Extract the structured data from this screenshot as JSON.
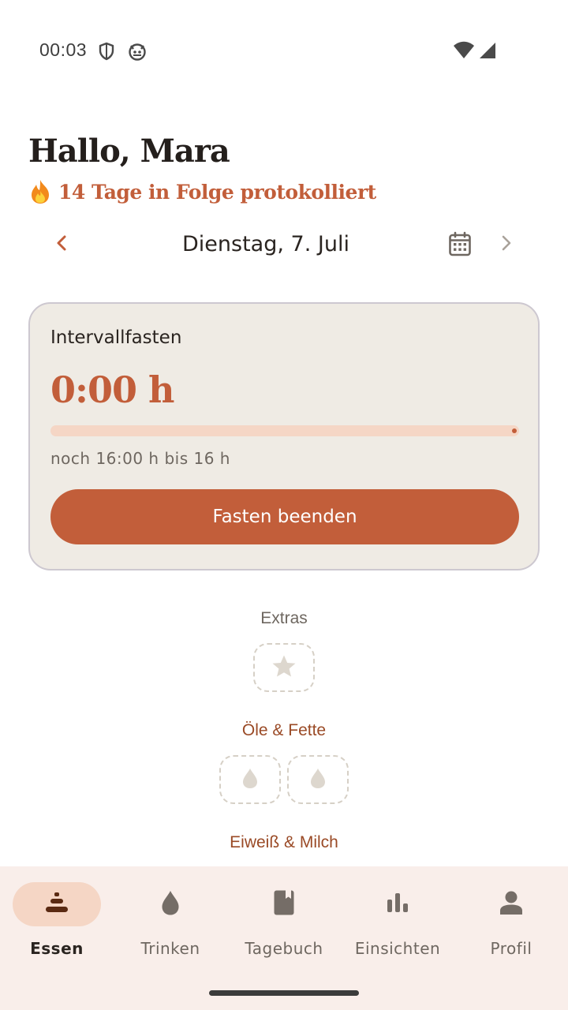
{
  "status_bar": {
    "time": "00:03",
    "icons": [
      "shield-icon",
      "cat-face-icon",
      "wifi-icon",
      "cell-signal-icon"
    ]
  },
  "header": {
    "greeting": "Hallo, Mara",
    "streak_text": "14 Tage in Folge protokolliert",
    "streak_icon": "flame-icon"
  },
  "date_nav": {
    "date": "Dienstag, 7. Juli",
    "prev_icon": "chevron-left-icon",
    "next_icon": "chevron-right-icon",
    "calendar_icon": "calendar-icon"
  },
  "fasting": {
    "title": "Intervallfasten",
    "elapsed": "0:00 h",
    "progress_fraction": 0,
    "remaining": "noch 16:00 h bis 16 h",
    "button_label": "Fasten beenden"
  },
  "sections": {
    "extras": {
      "label": "Extras",
      "slots": [
        "star-icon"
      ]
    },
    "oils": {
      "label": "Öle & Fette",
      "slots": [
        "drop-icon",
        "drop-icon"
      ]
    },
    "protein": {
      "label": "Eiweiß & Milch"
    }
  },
  "bottom_nav": {
    "active": "Essen",
    "items": [
      {
        "label": "Essen",
        "icon": "food-stack-icon"
      },
      {
        "label": "Trinken",
        "icon": "drop-icon"
      },
      {
        "label": "Tagebuch",
        "icon": "journal-icon"
      },
      {
        "label": "Einsichten",
        "icon": "bar-chart-icon"
      },
      {
        "label": "Profil",
        "icon": "person-icon"
      }
    ]
  },
  "colors": {
    "accent": "#c25e3a",
    "card_bg": "#efebe4",
    "progress_track": "#f5d6c5",
    "nav_bg": "#f9eeea",
    "section_brown": "#9a4a26"
  }
}
